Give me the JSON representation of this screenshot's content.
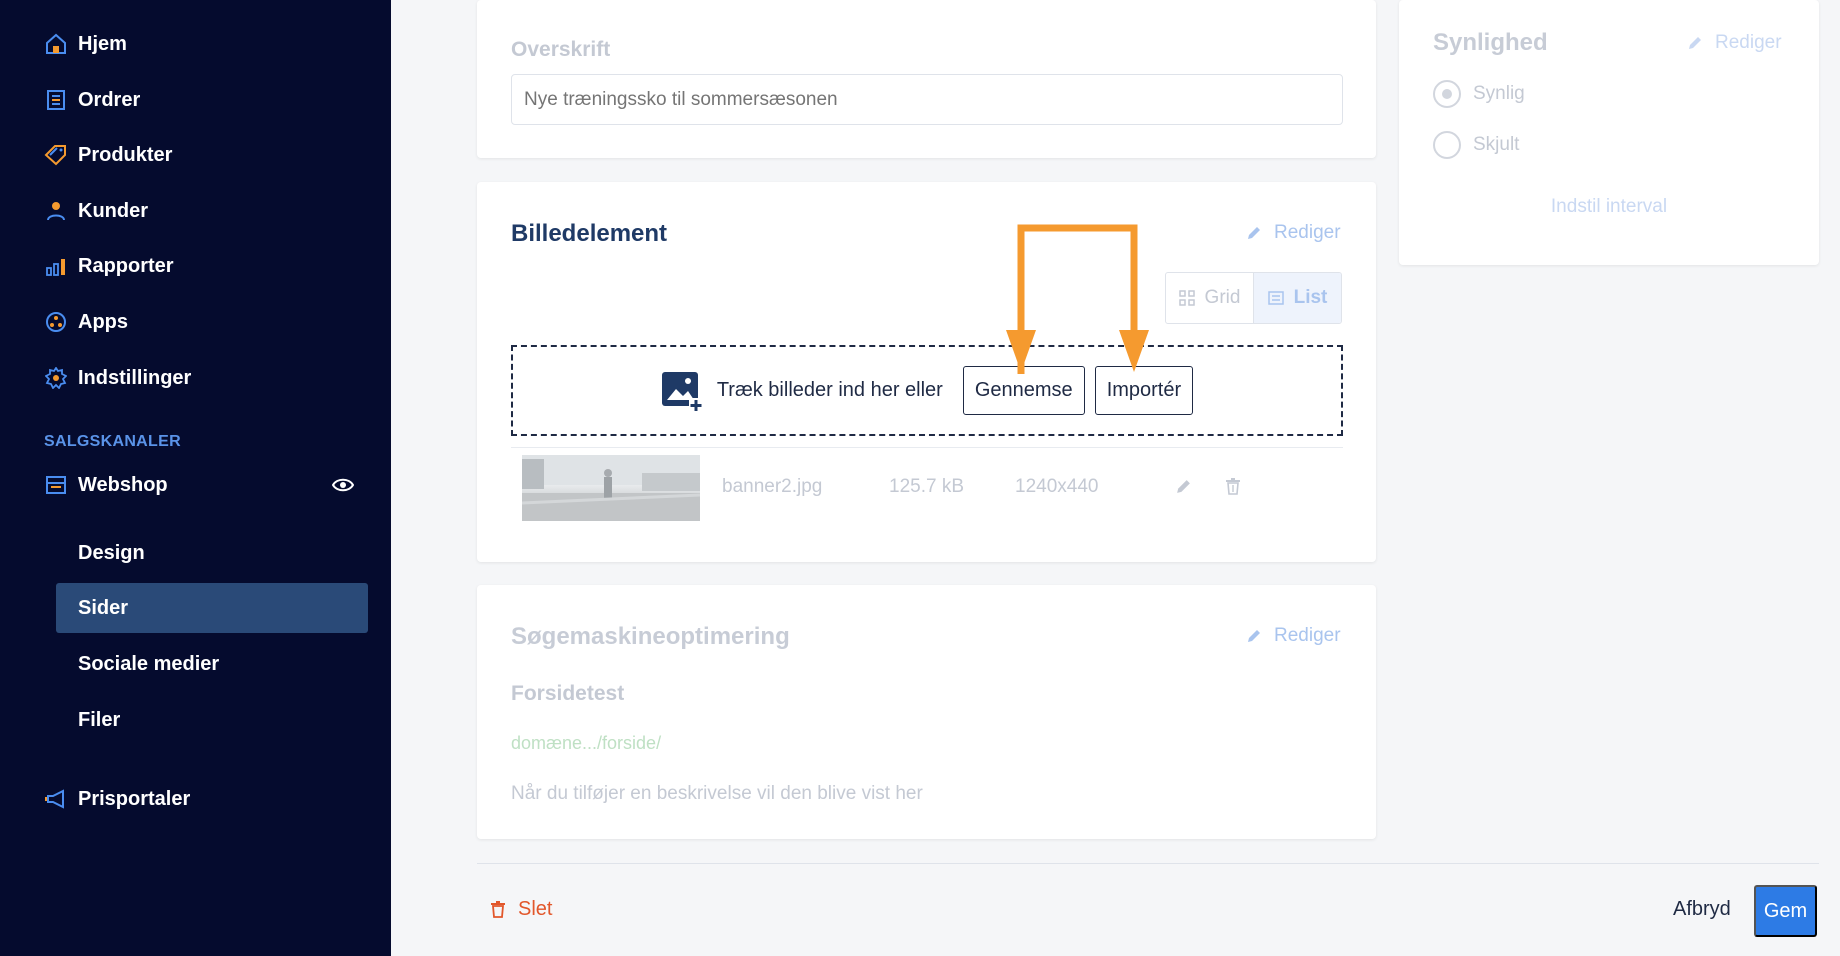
{
  "sidebar": {
    "items": [
      {
        "label": "Hjem",
        "icon": "home-icon"
      },
      {
        "label": "Ordrer",
        "icon": "orders-icon"
      },
      {
        "label": "Produkter",
        "icon": "tag-icon"
      },
      {
        "label": "Kunder",
        "icon": "user-icon"
      },
      {
        "label": "Rapporter",
        "icon": "bar-chart-icon"
      },
      {
        "label": "Apps",
        "icon": "apps-icon"
      },
      {
        "label": "Indstillinger",
        "icon": "gear-icon"
      }
    ],
    "section_label": "SALGSKANALER",
    "webshop_label": "Webshop",
    "sub_items": [
      {
        "label": "Design"
      },
      {
        "label": "Sider"
      },
      {
        "label": "Sociale medier"
      },
      {
        "label": "Filer"
      }
    ],
    "active_sub_item": "Sider",
    "prisportaler_label": "Prisportaler"
  },
  "heading_card": {
    "label": "Overskrift",
    "placeholder": "Nye træningssko til sommersæsonen"
  },
  "image_card": {
    "title": "Billedelement",
    "edit_label": "Rediger",
    "view_toggle": {
      "grid_label": "Grid",
      "list_label": "List",
      "selected": "List"
    },
    "dropzone": {
      "text": "Træk billeder ind her eller",
      "browse_label": "Gennemse",
      "import_label": "Importér"
    },
    "files": [
      {
        "name": "banner2.jpg",
        "size": "125.7 kB",
        "dimensions": "1240x440"
      }
    ]
  },
  "seo_card": {
    "title": "Søgemaskineoptimering",
    "edit_label": "Rediger",
    "page_title": "Forsidetest",
    "url": "domæne.../forside/",
    "description": "Når du tilføjer en beskrivelse vil den blive vist her"
  },
  "visibility_card": {
    "title": "Synlighed",
    "edit_label": "Rediger",
    "options": [
      {
        "label": "Synlig",
        "selected": true
      },
      {
        "label": "Skjult",
        "selected": false
      }
    ],
    "interval_label": "Indstil interval"
  },
  "footer": {
    "delete_label": "Slet",
    "cancel_label": "Afbryd",
    "save_label": "Gem"
  },
  "colors": {
    "sidebar_bg": "#050b2e",
    "sidebar_active": "#2a4a78",
    "accent_orange": "#f59a2f",
    "primary_button": "#2d7be5",
    "delete_red": "#e2572b"
  }
}
